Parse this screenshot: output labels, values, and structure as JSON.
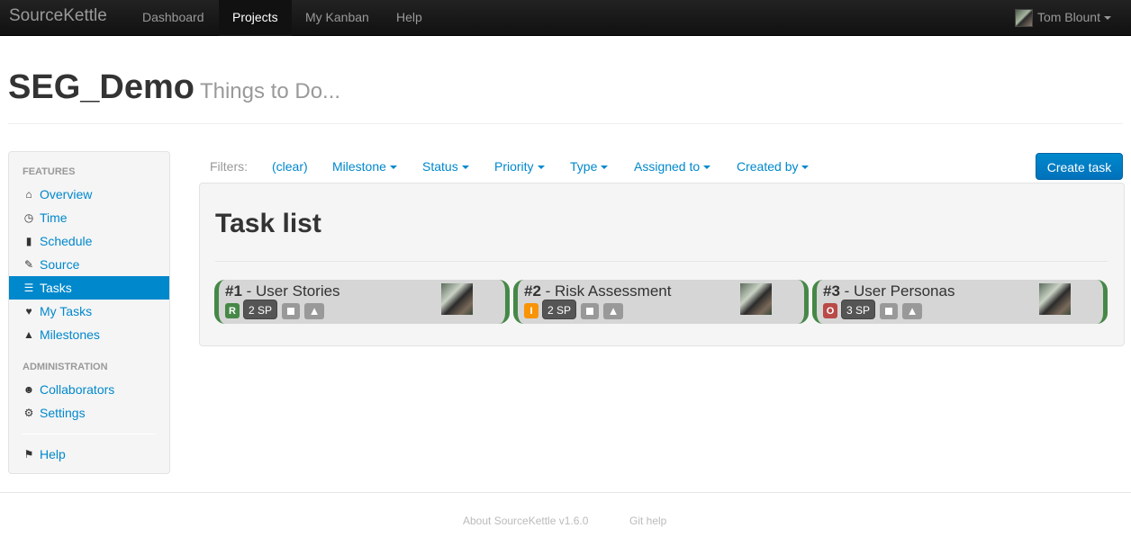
{
  "navbar": {
    "brand": "SourceKettle",
    "items": [
      {
        "label": "Dashboard"
      },
      {
        "label": "Projects"
      },
      {
        "label": "My Kanban"
      },
      {
        "label": "Help"
      }
    ],
    "active": "Projects",
    "user_name": "Tom Blount"
  },
  "header": {
    "title": "SEG_Demo",
    "subtitle": "Things to Do..."
  },
  "sidebar": {
    "features_heading": "FEATURES",
    "features": [
      {
        "label": "Overview",
        "icon": "home-icon"
      },
      {
        "label": "Time",
        "icon": "clock-icon"
      },
      {
        "label": "Schedule",
        "icon": "signal-icon"
      },
      {
        "label": "Source",
        "icon": "pencil-icon"
      },
      {
        "label": "Tasks",
        "icon": "list-icon"
      },
      {
        "label": "My Tasks",
        "icon": "heart-icon"
      },
      {
        "label": "Milestones",
        "icon": "road-icon"
      }
    ],
    "active": "Tasks",
    "admin_heading": "ADMINISTRATION",
    "admin": [
      {
        "label": "Collaborators",
        "icon": "user-icon"
      },
      {
        "label": "Settings",
        "icon": "cog-icon"
      }
    ],
    "help": {
      "label": "Help",
      "icon": "flag-icon"
    }
  },
  "filters": {
    "label": "Filters:",
    "clear": "(clear)",
    "items": [
      {
        "label": "Milestone"
      },
      {
        "label": "Status"
      },
      {
        "label": "Priority"
      },
      {
        "label": "Type"
      },
      {
        "label": "Assigned to"
      },
      {
        "label": "Created by"
      }
    ],
    "create_label": "Create task"
  },
  "task_list": {
    "title": "Task list",
    "tasks": [
      {
        "number": "#1",
        "sep": " - ",
        "name": "User Stories",
        "status": "R",
        "status_color": "#468847",
        "points": "2 SP"
      },
      {
        "number": "#2",
        "sep": " - ",
        "name": "Risk Assessment",
        "status": "I",
        "status_color": "#f89406",
        "points": "2 SP"
      },
      {
        "number": "#3",
        "sep": " - ",
        "name": "User Personas",
        "status": "O",
        "status_color": "#b94a48",
        "points": "3 SP"
      }
    ],
    "card_border_color": "#468847"
  },
  "footer": {
    "about": "About SourceKettle v1.6.0",
    "git_help": "Git help"
  },
  "colors": {
    "accent": "#0088cc",
    "navbar": "#1b1b1b"
  }
}
